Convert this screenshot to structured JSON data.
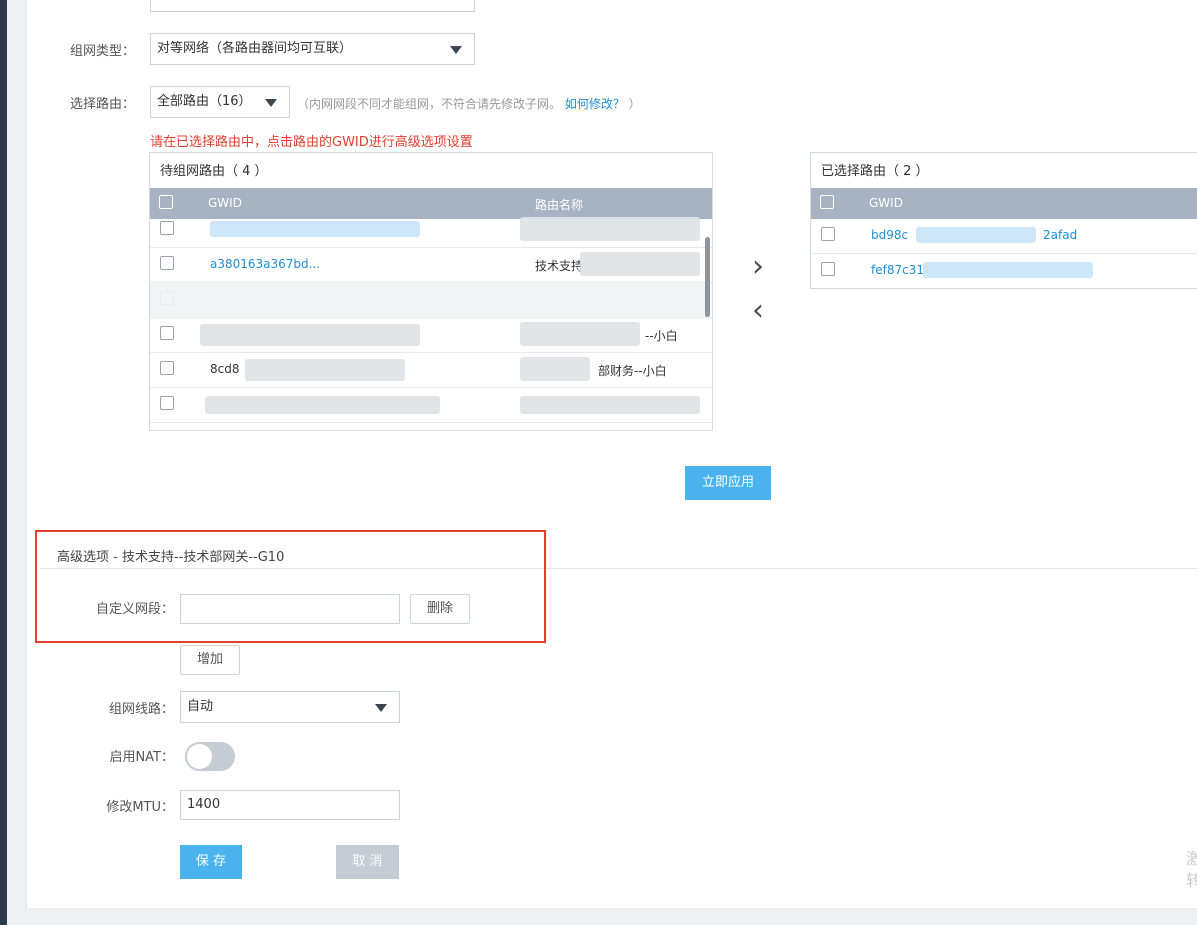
{
  "form": {
    "network_type_label": "组网类型：",
    "network_type_value": "对等网络（各路由器间均可互联）",
    "select_router_label": "选择路由：",
    "select_router_value": "全部路由（16）",
    "hint_text": "（内网网段不同才能组网，不符合请先修改子网。",
    "hint_link": "如何修改？",
    "hint_tail": "）",
    "warning": "请在已选择路由中，点击路由的GWID进行高级选项设置"
  },
  "pending_table": {
    "title": "待组网路由（ 4 ）",
    "col_gwid": "GWID",
    "col_name": "路由名称",
    "rows": [
      {
        "gwid": "",
        "name": "",
        "link": false
      },
      {
        "gwid": "a380163a367bd...",
        "name": "技术支持",
        "link": true
      },
      {
        "gwid": "",
        "name": "",
        "link": false
      },
      {
        "gwid": "",
        "name": "--小白",
        "link": false
      },
      {
        "gwid": "8cd8",
        "name": "部财务--小白",
        "link": false
      },
      {
        "gwid": "",
        "name": "",
        "link": false
      }
    ]
  },
  "selected_table": {
    "title": "已选择路由（ 2 ）",
    "col_gwid": "GWID",
    "rows": [
      {
        "gwid_start": "bd98c",
        "gwid_end": "2afad"
      },
      {
        "gwid_start": "fef87c31",
        "gwid_end": ""
      }
    ]
  },
  "arrows": {
    "right": "›",
    "left": "‹"
  },
  "apply_button": "立即应用",
  "advanced": {
    "title": "高级选项 - 技术支持--技术部网关--G10",
    "custom_segment_label": "自定义网段：",
    "custom_segment_value": "",
    "delete_button": "删除",
    "add_button": "增加",
    "line_label": "组网线路：",
    "line_value": "自动",
    "nat_label": "启用NAT：",
    "nat_enabled": false,
    "mtu_label": "修改MTU：",
    "mtu_value": "1400"
  },
  "footer": {
    "save_button": "保 存",
    "cancel_button": "取 消"
  },
  "corner_text": [
    "激",
    "转"
  ]
}
